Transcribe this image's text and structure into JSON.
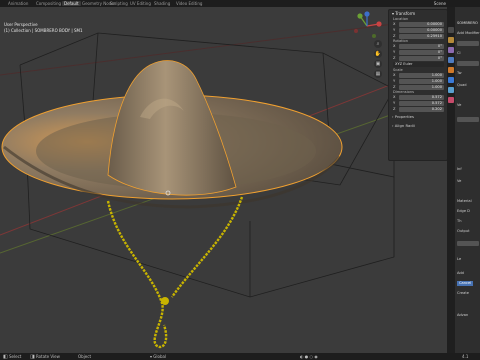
{
  "workspace_tabs": [
    "Animation",
    "Compositing",
    "Default",
    "Geometry Nodes",
    "Scripting",
    "UV Editing",
    "Shading",
    "Video Editing"
  ],
  "scene_label": "Scene",
  "viewport": {
    "mode_line": "User Perspective",
    "collection_line": "(1) Collection | SOMBRERO BODY | SM1"
  },
  "gizmo": {
    "x": "X",
    "y": "Y",
    "z": "Z"
  },
  "n_panel": {
    "title": "Transform",
    "location": {
      "label": "Location",
      "x": "0.00000",
      "y": "0.00000",
      "z": "0.25910"
    },
    "rotation": {
      "label": "Rotation",
      "x": "0°",
      "y": "0°",
      "z": "0°"
    },
    "rotation_mode": "XYZ Euler",
    "scale": {
      "label": "Scale",
      "x": "1.000",
      "y": "1.000",
      "z": "1.000"
    },
    "dimensions": {
      "label": "Dimensions",
      "x": "0.572",
      "y": "0.572",
      "z": "0.202"
    },
    "properties_label": "Properties",
    "align_label": "Align Radii"
  },
  "properties_editor": {
    "object_name": "SOMBRERO",
    "add_modifier": "Add Modifier",
    "rows": [
      "Cl",
      "Tw",
      "Quad",
      "Ve",
      "Inf",
      "Ve",
      "Material",
      "Edge D",
      "Th",
      "Output",
      "Le",
      "Add",
      "Cancel",
      "Create",
      "Advan"
    ]
  },
  "status_bar": {
    "left": [
      "Select",
      "Rotate View",
      "Object"
    ],
    "version": "4.1"
  },
  "colors": {
    "selection_outline": "#f0a030",
    "cord": "#c8b400",
    "x_axis": "#9b3535",
    "y_axis": "#6d8a2a",
    "active_tab": "#3a3a3a"
  }
}
